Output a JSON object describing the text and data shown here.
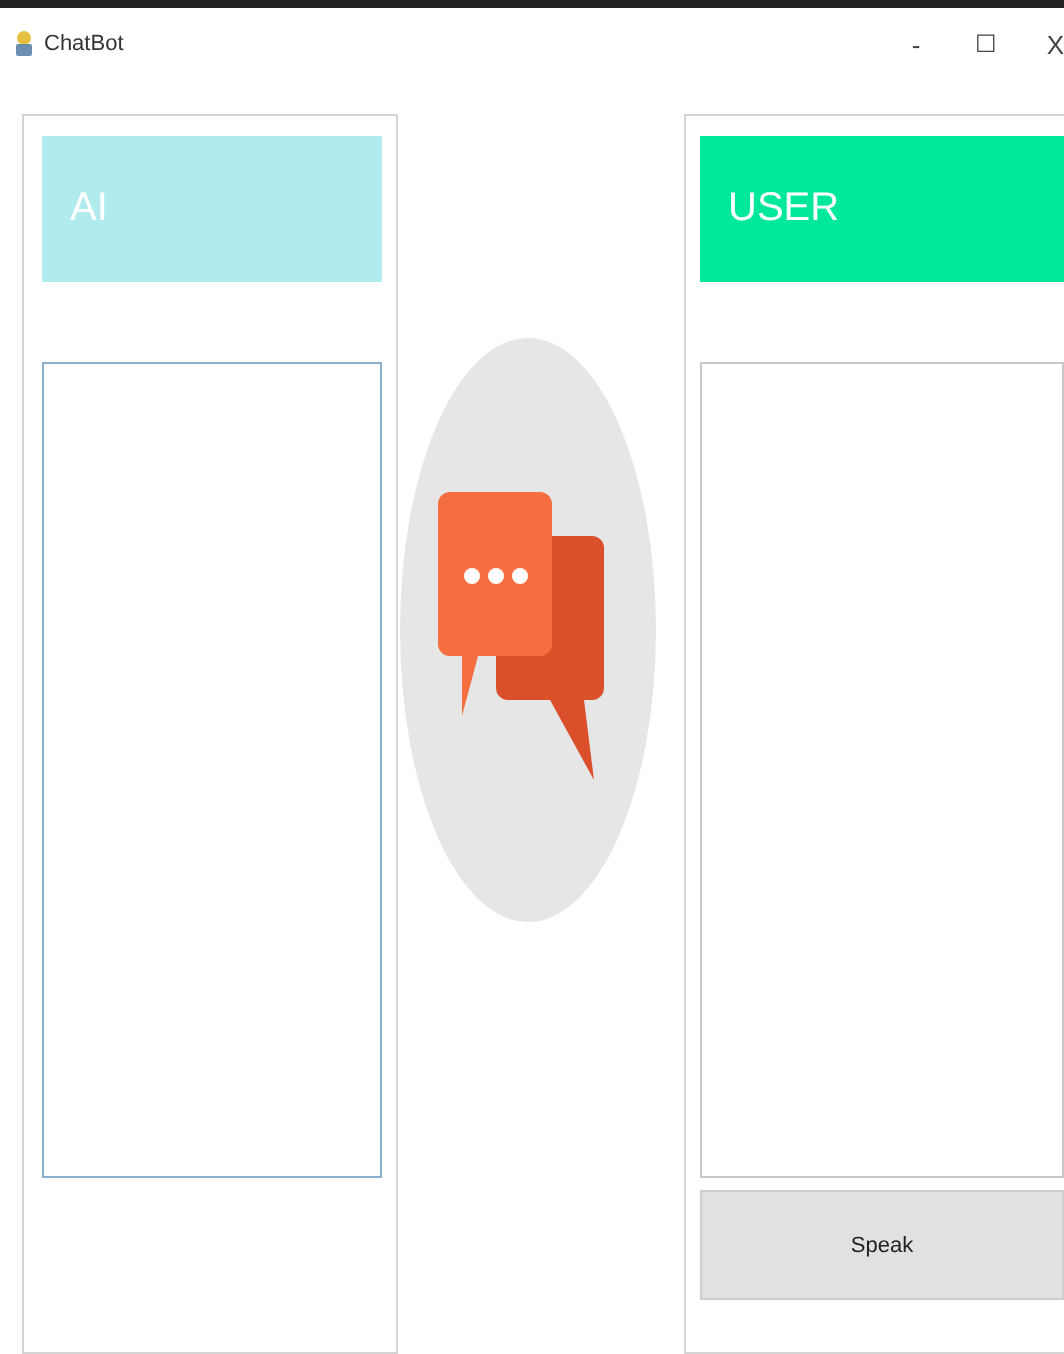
{
  "window": {
    "title": "ChatBot",
    "controls": [
      {
        "kind": "minimize",
        "label": "-"
      },
      {
        "kind": "maximize",
        "label": "☐"
      },
      {
        "kind": "close",
        "label": "X"
      }
    ]
  },
  "panels": [
    {
      "kind": "ai",
      "header": "AI",
      "color": "#b0ecee"
    },
    {
      "kind": "user",
      "header": "USER",
      "color": "#00e89a",
      "button": "Speak"
    }
  ]
}
